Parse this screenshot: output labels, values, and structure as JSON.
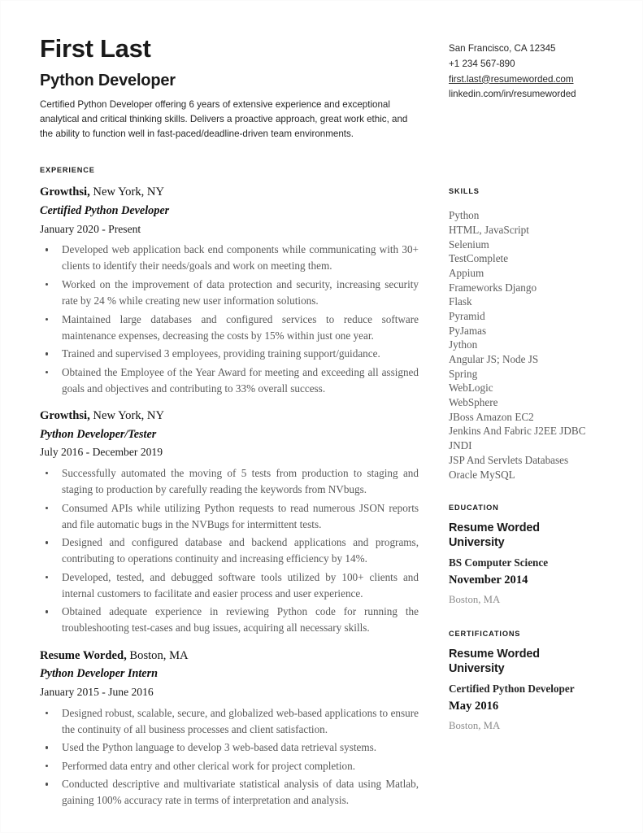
{
  "header": {
    "name": "First Last",
    "headline": "Python Developer",
    "summary": "Certified Python Developer offering 6 years of extensive experience and exceptional analytical and critical thinking skills. Delivers a proactive approach, great work ethic, and the ability to function well in fast-paced/deadline-driven team environments."
  },
  "contact": {
    "location": "San Francisco, CA 12345",
    "phone": "+1 234 567-890",
    "email": "first.last@resumeworded.com",
    "linkedin": "linkedin.com/in/resumeworded"
  },
  "experience": {
    "section_title": "EXPERIENCE",
    "jobs": [
      {
        "company": "Growthsi,",
        "location": "New York, NY",
        "title": "Certified Python Developer",
        "dates": "January 2020 - Present",
        "bullets": [
          "Developed web application back end components while communicating with 30+ clients to identify their needs/goals and work on meeting them.",
          "Worked on the improvement of data protection and security, increasing security rate by 24 %  while creating new user information solutions.",
          "Maintained large databases and configured services to reduce software maintenance expenses, decreasing the costs by 15% within just one year.",
          "Trained and supervised 3 employees, providing training support/guidance.",
          "Obtained the Employee of the Year Award for meeting and exceeding all assigned goals and objectives and contributing to 33% overall success."
        ]
      },
      {
        "company": "Growthsi,",
        "location": "New York, NY",
        "title": "Python Developer/Tester",
        "dates": "July 2016 - December 2019",
        "bullets": [
          "Successfully automated the moving of 5 tests from production to staging and staging to production by carefully reading the keywords from NVbugs.",
          "Consumed APIs while utilizing Python requests to read numerous JSON reports and file automatic bugs in the NVBugs for intermittent tests.",
          "Designed and configured database and backend applications and programs, contributing to operations continuity and increasing efficiency by 14%.",
          "Developed, tested, and debugged software tools utilized by 100+ clients and internal customers to facilitate and easier process and user experience.",
          "Obtained adequate experience in reviewing Python code for running the troubleshooting test-cases and bug issues, acquiring all necessary skills."
        ]
      },
      {
        "company": "Resume Worded,",
        "location": "Boston, MA",
        "title": "Python Developer Intern",
        "dates": "January 2015 - June 2016",
        "bullets": [
          "Designed robust, scalable, secure, and globalized web-based applications to ensure the continuity of all business processes and client satisfaction.",
          "Used the Python language to develop 3 web-based data retrieval systems.",
          "Performed data entry and other clerical work for project completion.",
          "Conducted descriptive and multivariate statistical analysis of data using Matlab, gaining 100% accuracy rate in terms of interpretation and analysis."
        ]
      }
    ]
  },
  "skills": {
    "section_title": "SKILLS",
    "items": [
      "Python",
      "HTML, JavaScript",
      "Selenium",
      "TestComplete",
      "Appium",
      "Frameworks Django",
      "Flask",
      "Pyramid",
      "PyJamas",
      "Jython",
      "Angular JS; Node JS",
      "Spring",
      "WebLogic",
      "WebSphere",
      "JBoss Amazon EC2",
      "Jenkins And Fabric J2EE JDBC",
      "JNDI",
      "JSP And Servlets Databases",
      "Oracle MySQL"
    ]
  },
  "education": {
    "section_title": "EDUCATION",
    "school": "Resume Worded University",
    "degree": "BS Computer Science",
    "date": "November 2014",
    "location": "Boston, MA"
  },
  "certifications": {
    "section_title": "CERTIFICATIONS",
    "issuer": "Resume Worded University",
    "name": "Certified Python Developer",
    "date": "May 2016",
    "location": "Boston, MA"
  }
}
